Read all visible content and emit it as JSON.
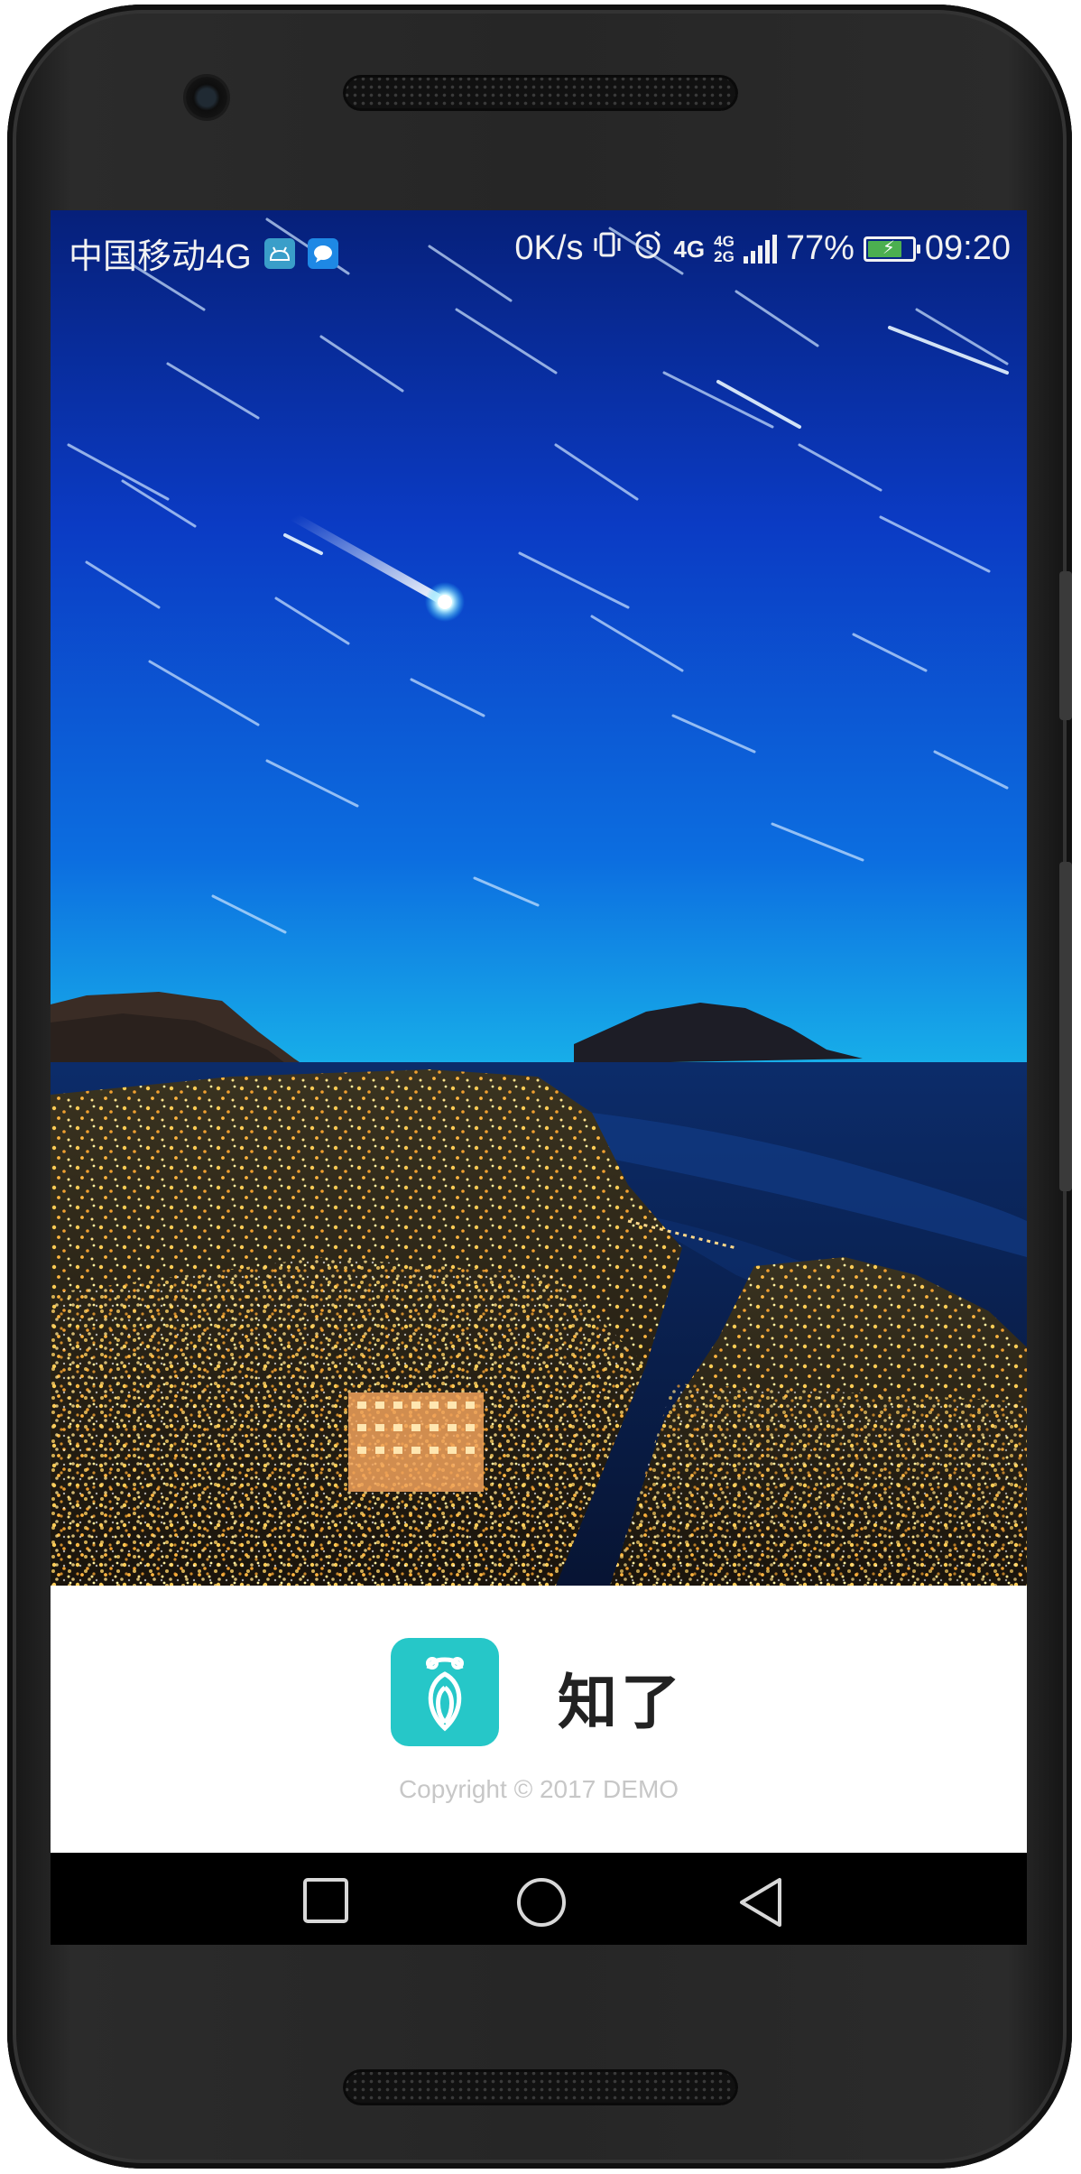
{
  "status_bar": {
    "carrier": "中国移动4G",
    "notification_icons": [
      "android-icon",
      "message-icon"
    ],
    "network_speed": "0K/s",
    "network_type": "4G",
    "network_stack_top": "4G",
    "network_stack_bottom": "2G",
    "battery_percent_text": "77%",
    "battery_level": 0.77,
    "time": "09:20"
  },
  "brand": {
    "app_name": "知了",
    "logo_icon": "cicada-logo-icon",
    "logo_color": "#26c7c8",
    "copyright": "Copyright © 2017 DEMO"
  },
  "navigation": {
    "buttons": [
      "recents-button",
      "home-button",
      "back-button"
    ]
  },
  "colors": {
    "sky_top": "#0b2aa0",
    "sky_horizon": "#1fb6e8",
    "city_lights": "#f3b33a"
  }
}
